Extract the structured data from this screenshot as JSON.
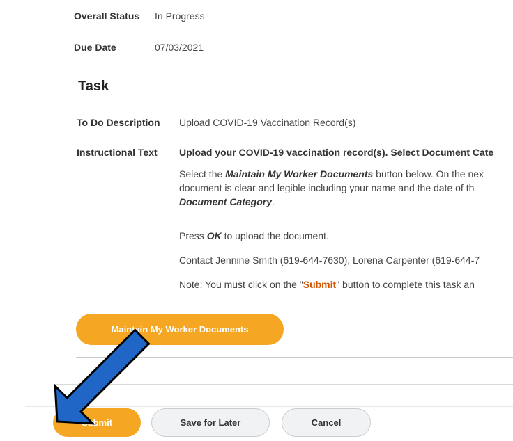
{
  "header_fields": {
    "overall_status_label": "Overall Status",
    "overall_status_value": "In Progress",
    "due_date_label": "Due Date",
    "due_date_value": "07/03/2021"
  },
  "task": {
    "title": "Task",
    "todo_label": "To Do Description",
    "todo_value": "Upload COVID-19 Vaccination Record(s)",
    "instructional_label": "Instructional Text",
    "instructional_heading": "Upload your COVID-19 vaccination record(s). Select Document Cate",
    "para1_prefix": "Select the ",
    "para1_em": "Maintain My Worker Documents",
    "para1_suffix": " button below. On the nex",
    "para1_line2": "document is clear and legible including your name and the date of th",
    "para1_line3_em": "Document Category",
    "para1_line3_suffix": ".",
    "para2_prefix": "Press ",
    "para2_em": "OK",
    "para2_suffix": " to upload the document.",
    "para3": "Contact Jennine Smith (619-644-7630), Lorena Carpenter (619-644-7",
    "para4_prefix": "Note: You must click on the \"",
    "para4_submit": "Submit",
    "para4_suffix": "\" button to complete this task an"
  },
  "maintain_button_label": "Maintain My Worker Documents",
  "footer": {
    "submit_label": "Submit",
    "save_later_label": "Save for Later",
    "cancel_label": "Cancel"
  },
  "colors": {
    "primary_orange": "#f5a623",
    "submit_highlight": "#d35400",
    "arrow_blue": "#1f66c6"
  },
  "icons": {
    "annotation": "blue-arrow-pointing-to-submit"
  }
}
